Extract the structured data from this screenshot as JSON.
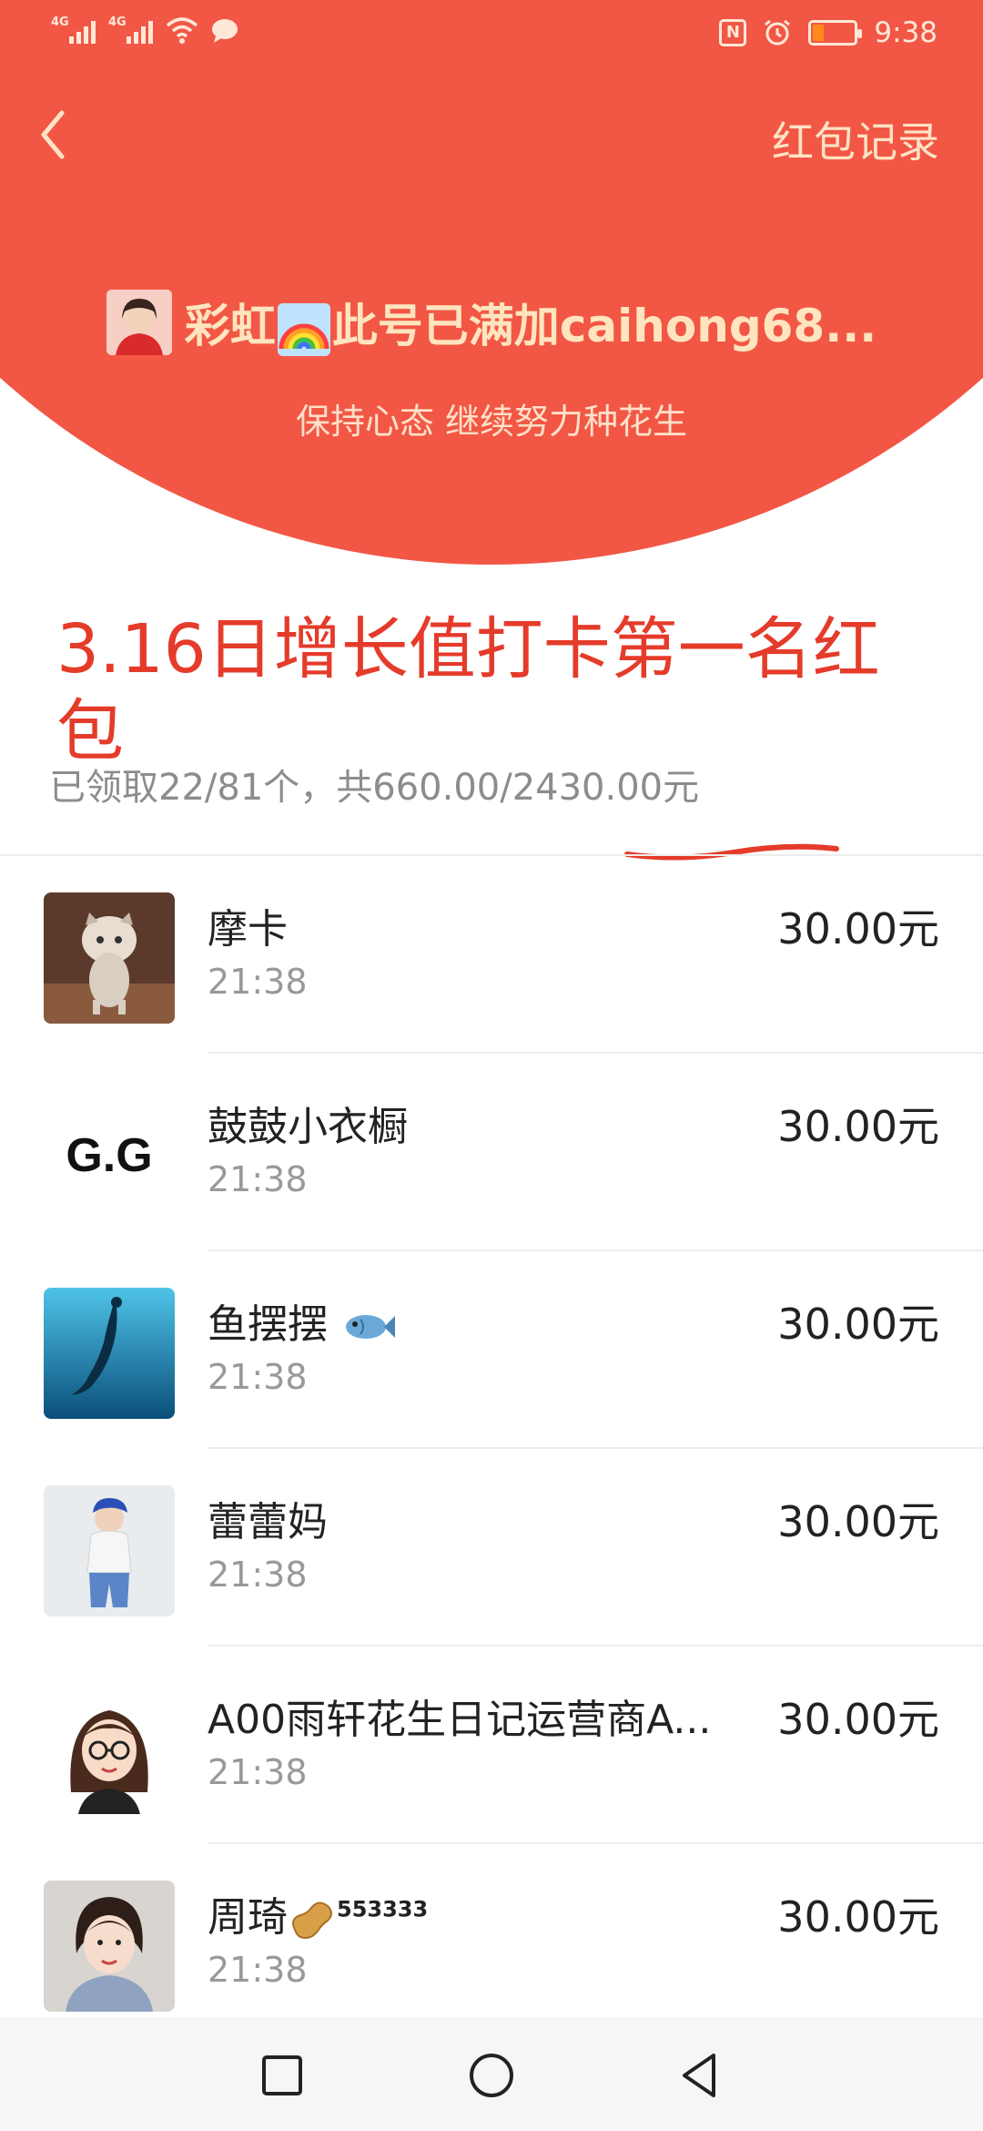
{
  "status_bar": {
    "signal1_label": "4G",
    "signal2_label": "4G",
    "nfc_label": "N",
    "time": "9:38"
  },
  "header": {
    "history_label": "红包记录",
    "sender_name_prefix": "彩虹",
    "sender_name_suffix": "此号已满加caihong68...",
    "greeting": "保持心态 继续努力种花生"
  },
  "summary": {
    "title": "3.16日增长值打卡第一名红包",
    "received_text": "已领取22/81个，共660.00/2430.00元"
  },
  "records": [
    {
      "name": "摩卡",
      "time": "21:38",
      "amount": "30.00元",
      "avatar": "cat"
    },
    {
      "name": "鼓鼓小衣橱",
      "time": "21:38",
      "amount": "30.00元",
      "avatar": "gg-logo",
      "logo_text": "G.G"
    },
    {
      "name": "鱼摆摆",
      "time": "21:38",
      "amount": "30.00元",
      "avatar": "mermaid",
      "emoji": "fish-icon"
    },
    {
      "name": "蕾蕾妈",
      "time": "21:38",
      "amount": "30.00元",
      "avatar": "child"
    },
    {
      "name": "A00雨轩花生日记运营商A...",
      "time": "21:38",
      "amount": "30.00元",
      "avatar": "cartoon-girl"
    },
    {
      "name": "周琦",
      "time": "21:38",
      "amount": "30.00元",
      "avatar": "woman",
      "emoji": "peanut-icon",
      "suffix": "553333"
    }
  ],
  "colors": {
    "header_red": "#f25745",
    "annotation_red": "#e53b2a",
    "gold_text": "#ffe5bf"
  }
}
